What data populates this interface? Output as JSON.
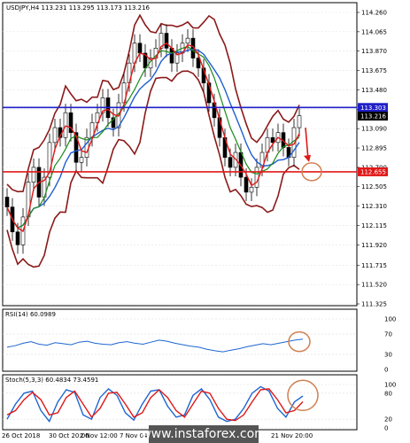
{
  "chart_data": [
    {
      "type": "candlestick",
      "title": "USDJPY,H4  113.231 113.295 113.173 113.216",
      "ylim": [
        111.325,
        114.26
      ],
      "y_ticks": [
        "114.260",
        "114.065",
        "113.870",
        "113.675",
        "113.480",
        "113.285",
        "113.090",
        "112.895",
        "112.700",
        "112.505",
        "112.310",
        "112.115",
        "111.920",
        "111.715",
        "111.520",
        "111.325"
      ],
      "x_ticks": [
        "26 Oct 2018",
        "30 Oct 20:00",
        "2 Nov 12:00",
        "7 Nov 04:00",
        "",
        "",
        "",
        "",
        "21 Nov 20:00"
      ],
      "close": [
        112.3,
        112.05,
        111.92,
        112.2,
        112.55,
        112.7,
        112.4,
        112.6,
        112.95,
        113.1,
        113.0,
        113.25,
        113.05,
        112.75,
        112.8,
        113.0,
        113.15,
        113.25,
        113.4,
        113.2,
        113.1,
        113.35,
        113.55,
        113.75,
        113.95,
        113.85,
        113.7,
        113.8,
        113.9,
        114.05,
        113.9,
        113.75,
        113.85,
        113.95,
        114.0,
        113.8,
        113.7,
        113.55,
        113.35,
        113.2,
        113.0,
        112.8,
        112.7,
        112.85,
        112.6,
        112.45,
        112.5,
        112.7,
        112.85,
        113.0,
        112.95,
        113.05,
        112.9,
        112.8,
        113.1,
        113.22
      ],
      "horizontal_lines": [
        {
          "value": 113.303,
          "label": "113.303",
          "color": "#1f1fc8"
        },
        {
          "value": 112.655,
          "label": "112.655",
          "color": "#e01818"
        }
      ],
      "last_price": {
        "value": 113.216,
        "label": "113.216"
      }
    },
    {
      "type": "line",
      "title": "RSI(14) 60.0989",
      "ylim": [
        0,
        100
      ],
      "y_ticks": [
        "100",
        "70",
        "30",
        "0"
      ],
      "series": [
        {
          "name": "RSI(14)",
          "color": "#1e66d0",
          "values": [
            44,
            47,
            52,
            55,
            50,
            48,
            53,
            51,
            49,
            54,
            56,
            52,
            50,
            49,
            53,
            55,
            52,
            50,
            54,
            58,
            56,
            52,
            49,
            46,
            44,
            40,
            37,
            35,
            38,
            41,
            45,
            48,
            51,
            49,
            52,
            55,
            58,
            60.1
          ]
        }
      ]
    },
    {
      "type": "line",
      "title": "Stoch(5,3,3) 60.4834 73.4591",
      "ylim": [
        0,
        100
      ],
      "y_ticks": [
        "100",
        "80",
        "20",
        "0"
      ],
      "series": [
        {
          "name": "%K",
          "color": "#1e66d0",
          "values": [
            20,
            55,
            80,
            85,
            40,
            15,
            60,
            88,
            82,
            30,
            20,
            70,
            90,
            75,
            35,
            18,
            55,
            85,
            88,
            50,
            25,
            30,
            75,
            90,
            65,
            25,
            15,
            20,
            45,
            80,
            95,
            85,
            45,
            25,
            60,
            73.5
          ]
        },
        {
          "name": "%D",
          "color": "#e01818",
          "values": [
            30,
            40,
            65,
            82,
            65,
            30,
            35,
            70,
            85,
            55,
            25,
            45,
            80,
            82,
            55,
            25,
            35,
            70,
            88,
            70,
            40,
            25,
            55,
            85,
            80,
            45,
            20,
            17,
            30,
            60,
            88,
            90,
            65,
            35,
            40,
            60.5
          ]
        }
      ]
    }
  ],
  "watermark": "www.instaforex.com"
}
